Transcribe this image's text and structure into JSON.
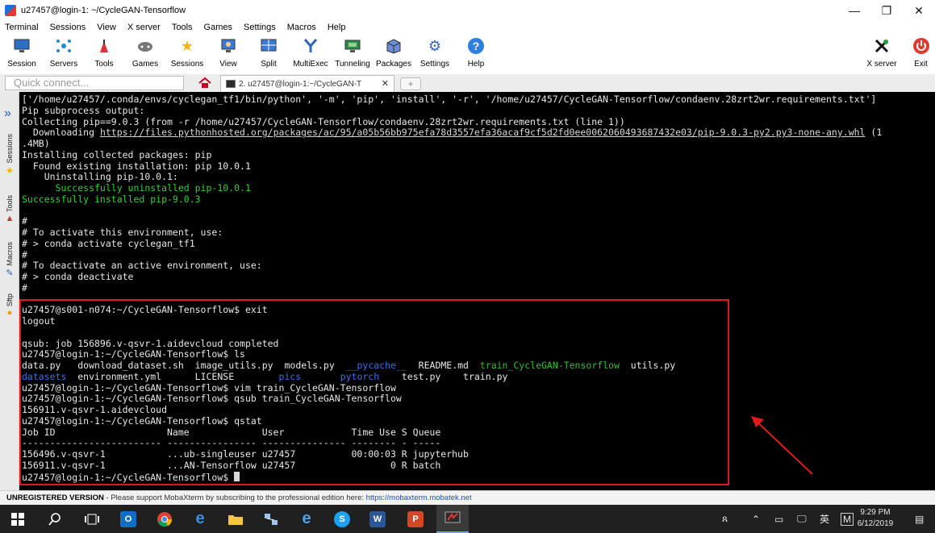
{
  "window": {
    "title": "u27457@login-1: ~/CycleGAN-Tensorflow"
  },
  "window_controls": {
    "minimize": "—",
    "restore": "❐",
    "close": "✕"
  },
  "menu": [
    "Terminal",
    "Sessions",
    "View",
    "X server",
    "Tools",
    "Games",
    "Settings",
    "Macros",
    "Help"
  ],
  "toolbar": {
    "items": [
      {
        "label": "Session",
        "icon": "session-icon"
      },
      {
        "label": "Servers",
        "icon": "servers-icon"
      },
      {
        "label": "Tools",
        "icon": "tools-icon"
      },
      {
        "label": "Games",
        "icon": "games-icon"
      },
      {
        "label": "Sessions",
        "icon": "star-icon"
      },
      {
        "label": "View",
        "icon": "view-icon"
      },
      {
        "label": "Split",
        "icon": "split-icon"
      },
      {
        "label": "MultiExec",
        "icon": "multiexec-icon"
      },
      {
        "label": "Tunneling",
        "icon": "tunneling-icon"
      },
      {
        "label": "Packages",
        "icon": "packages-icon"
      },
      {
        "label": "Settings",
        "icon": "settings-icon"
      },
      {
        "label": "Help",
        "icon": "help-icon"
      }
    ],
    "xserver_label": "X server",
    "exit_label": "Exit"
  },
  "tabs": {
    "quick_connect_placeholder": "Quick connect...",
    "active_tab_label": "2. u27457@login-1:~/CycleGAN-T",
    "close_glyph": "✕",
    "new_tab_glyph": "+"
  },
  "sidebar": {
    "tabs": [
      "Sessions",
      "Tools",
      "Macros",
      "Sftp"
    ]
  },
  "terminal": {
    "lines": [
      "['/home/u27457/.conda/envs/cyclegan_tf1/bin/python', '-m', 'pip', 'install', '-r', '/home/u27457/CycleGAN-Tensorflow/condaenv.28zrt2wr.requirements.txt']",
      "Pip subprocess output:",
      "Collecting pip==9.0.3 (from -r /home/u27457/CycleGAN-Tensorflow/condaenv.28zrt2wr.requirements.txt (line 1))",
      "  Downloading ",
      "https://files.pythonhosted.org/packages/ac/95/a05b56bb975efa78d3557efa36acaf9cf5d2fd0ee0062060493687432e03/pip-9.0.3-py2.py3-none-any.whl",
      " (1",
      ".4MB)",
      "Installing collected packages: pip",
      "  Found existing installation: pip 10.0.1",
      "    Uninstalling pip-10.0.1:",
      "      Successfully uninstalled pip-10.0.1",
      "Successfully installed pip-9.0.3",
      "#",
      "# To activate this environment, use:",
      "# > conda activate cyclegan_tf1",
      "#",
      "# To deactivate an active environment, use:",
      "# > conda deactivate",
      "#",
      "u27457@s001-n074:~/CycleGAN-Tensorflow$ exit",
      "logout",
      "qsub: job 156896.v-qsvr-1.aidevcloud completed",
      "u27457@login-1:~/CycleGAN-Tensorflow$ ls",
      "data.py",
      "download_dataset.sh",
      "image_utils.py",
      "models.py",
      "__pycache__",
      "README.md",
      "train_CycleGAN-Tensorflow",
      "utils.py",
      "datasets",
      "environment.yml",
      "LICENSE",
      "pics",
      "pytorch",
      "test.py",
      "train.py",
      "u27457@login-1:~/CycleGAN-Tensorflow$ vim train_CycleGAN-Tensorflow",
      "u27457@login-1:~/CycleGAN-Tensorflow$ qsub train_CycleGAN-Tensorflow",
      "156911.v-qsvr-1.aidevcloud",
      "u27457@login-1:~/CycleGAN-Tensorflow$ qstat",
      "Job ID                    Name             User            Time Use S Queue",
      "------------------------- ---------------- --------------- -------- - -----",
      "156496.v-qsvr-1           ...ub-singleuser u27457          00:00:03 R jupyterhub",
      "156911.v-qsvr-1           ...AN-Tensorflow u27457                 0 R batch",
      "u27457@login-1:~/CycleGAN-Tensorflow$ "
    ]
  },
  "status_bar": {
    "unregistered": "UNREGISTERED VERSION",
    "message": "  -  Please support MobaXterm by subscribing to the professional edition here:  ",
    "link": "https://mobaxterm.mobatek.net"
  },
  "taskbar": {
    "tray_ime": "英",
    "tray_m": "M",
    "time": "9:29 PM",
    "date": "6/12/2019"
  }
}
